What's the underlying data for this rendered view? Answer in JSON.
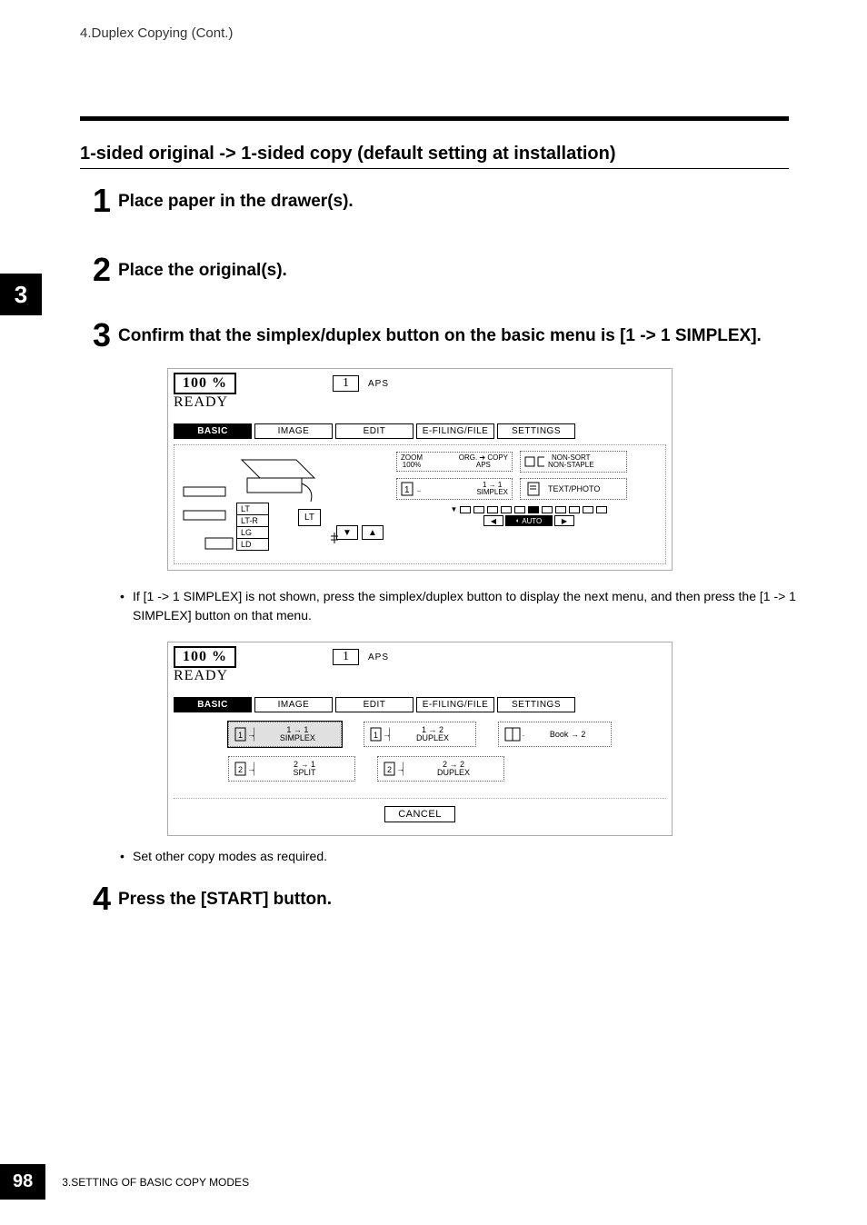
{
  "breadcrumb": "4.Duplex Copying (Cont.)",
  "section_title": "1-sided original -> 1-sided copy (default setting at installation)",
  "side_tab": "3",
  "steps": {
    "s1": {
      "num": "1",
      "text": "Place paper in the drawer(s)."
    },
    "s2": {
      "num": "2",
      "text": "Place the original(s)."
    },
    "s3": {
      "num": "3",
      "text": "Confirm that the simplex/duplex button on the basic menu is [1 -> 1 SIMPLEX]."
    },
    "s4": {
      "num": "4",
      "text": "Press the [START] button."
    }
  },
  "lcd1": {
    "percent": "100  %",
    "count": "1",
    "aps": "APS",
    "ready": "READY",
    "tabs": {
      "basic": "BASIC",
      "image": "IMAGE",
      "edit": "EDIT",
      "efiling": "E-FILING/FILE",
      "settings": "SETTINGS"
    },
    "paper": {
      "lt": "LT",
      "ltr": "LT-R",
      "lg": "LG",
      "ld": "LD",
      "ltbtn": "LT"
    },
    "right": {
      "zoom_top": "ZOOM",
      "zoom_bot": "100%",
      "org_top": "ORG. ➔ COPY",
      "org_bot": "APS",
      "sort_top": "NON-SORT",
      "sort_bot": "NON-STAPLE",
      "simplex_top": "1 → 1",
      "simplex_bot": "SIMPLEX",
      "textphoto": "TEXT/PHOTO",
      "auto": "AUTO"
    }
  },
  "note1": "If [1 -> 1 SIMPLEX] is not shown, press the simplex/duplex button to display the next menu, and then press the [1 -> 1 SIMPLEX] button on that menu.",
  "lcd2": {
    "percent": "100  %",
    "count": "1",
    "aps": "APS",
    "ready": "READY",
    "tabs": {
      "basic": "BASIC",
      "image": "IMAGE",
      "edit": "EDIT",
      "efiling": "E-FILING/FILE",
      "settings": "SETTINGS"
    },
    "buttons": {
      "b11_top": "1 → 1",
      "b11_bot": "SIMPLEX",
      "b12_top": "1 → 2",
      "b12_bot": "DUPLEX",
      "bbk": "Book → 2",
      "b21_top": "2 → 1",
      "b21_bot": "SPLIT",
      "b22_top": "2 → 2",
      "b22_bot": "DUPLEX"
    },
    "cancel": "CANCEL"
  },
  "note2": "Set other copy modes as required.",
  "footer": {
    "page": "98",
    "chapter": "3.SETTING OF BASIC COPY MODES"
  }
}
